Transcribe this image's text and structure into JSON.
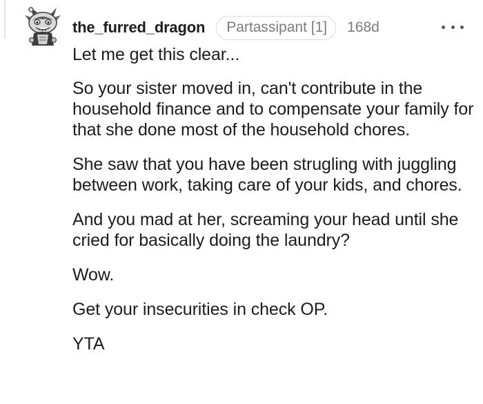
{
  "comment": {
    "author": "the_furred_dragon",
    "flair": "Partassipant [1]",
    "age": "168d",
    "avatar_icon": "snoo-dragon-avatar-icon",
    "more_icon": "more-options-icon",
    "paragraphs": [
      "Let me get this clear...",
      "So your sister moved in, can't contribute in the household finance and to compensate your family for that she done most of the household chores.",
      "She saw that you have been strugling with juggling between work, taking care of your kids, and chores.",
      "And you mad at her, screaming your head until she cried for basically doing the laundry?",
      "Wow.",
      "Get your insecurities in check OP.",
      "YTA"
    ]
  }
}
